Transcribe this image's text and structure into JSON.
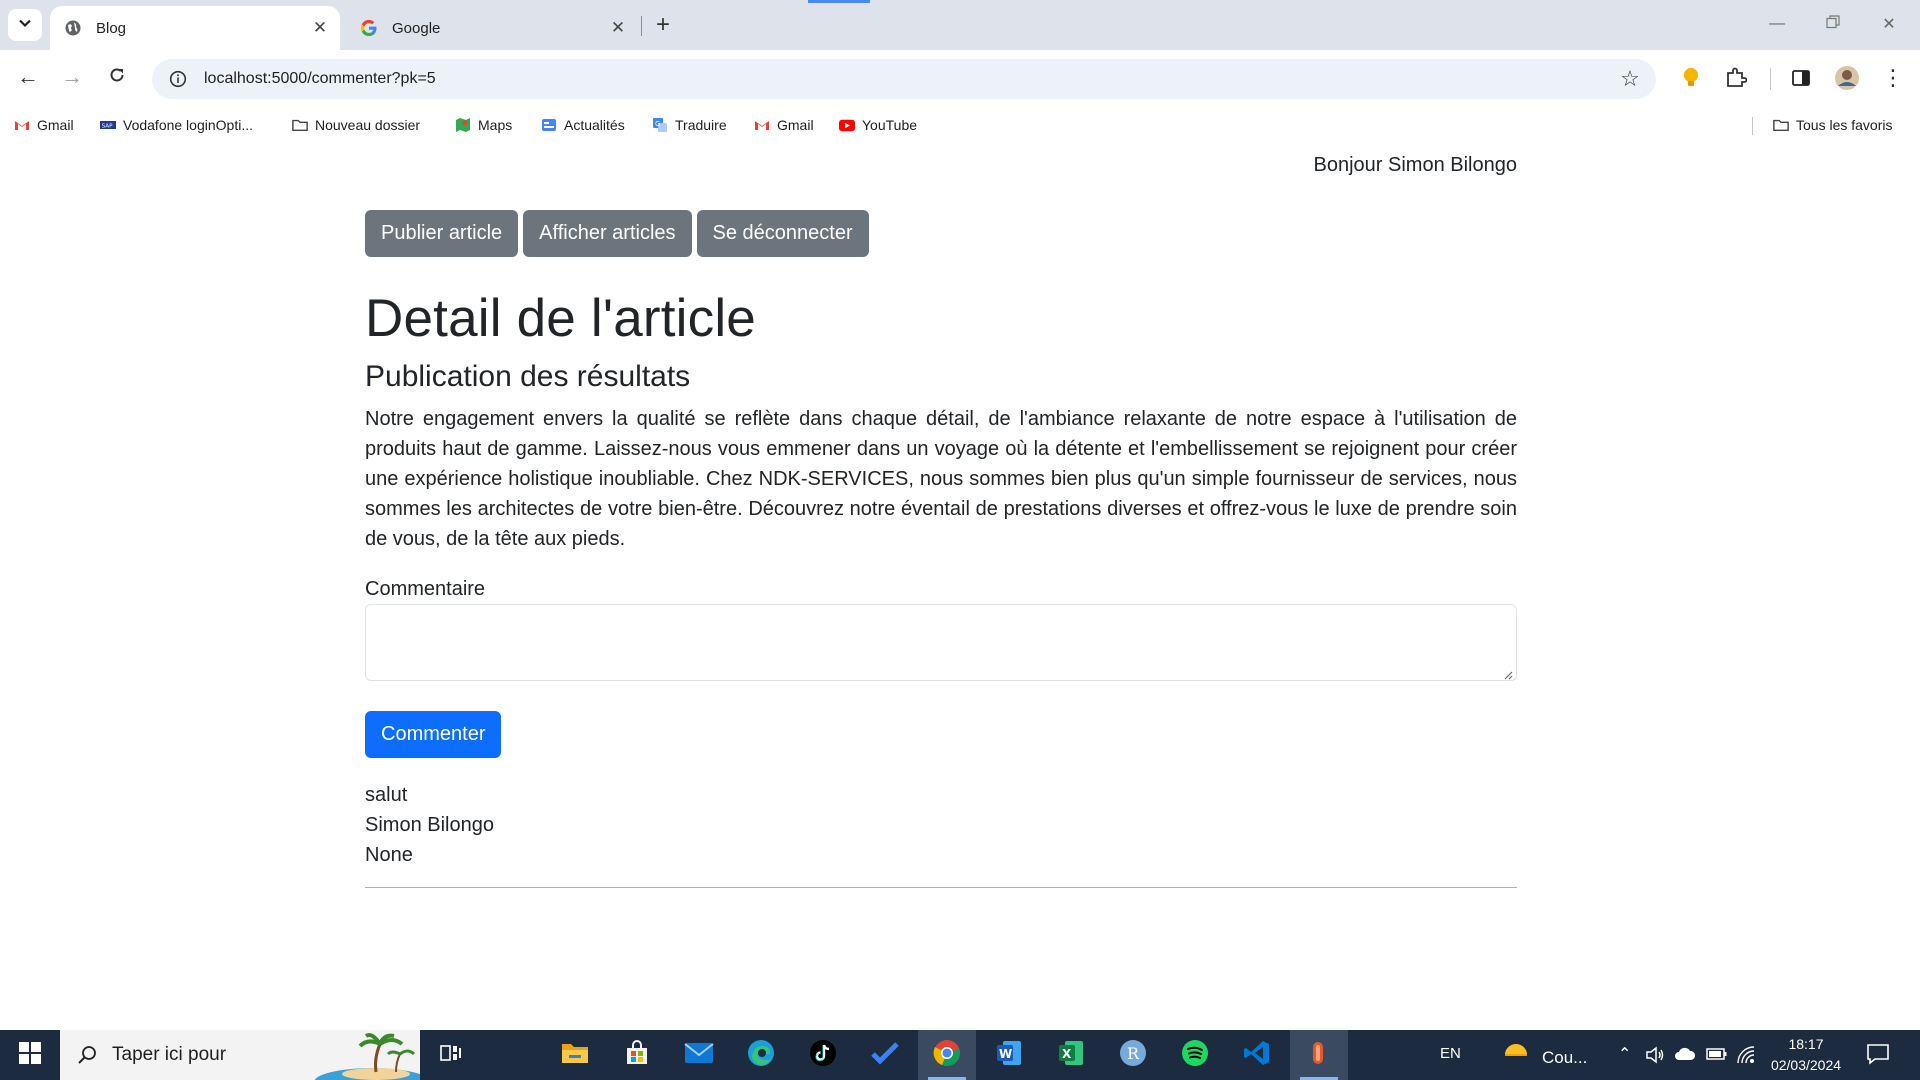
{
  "browser": {
    "tabs": [
      {
        "title": "Blog",
        "active": true
      },
      {
        "title": "Google",
        "active": false
      }
    ],
    "url": "localhost:5000/commenter?pk=5",
    "bookmarks": [
      {
        "label": "Gmail",
        "icon": "gmail-icon"
      },
      {
        "label": "Vodafone loginOpti...",
        "icon": "vodafone-icon"
      },
      {
        "label": "Nouveau dossier",
        "icon": "folder-icon"
      },
      {
        "label": "Maps",
        "icon": "maps-icon"
      },
      {
        "label": "Actualités",
        "icon": "news-icon"
      },
      {
        "label": "Traduire",
        "icon": "translate-icon"
      },
      {
        "label": "Gmail",
        "icon": "gmail-icon"
      },
      {
        "label": "YouTube",
        "icon": "youtube-icon"
      }
    ],
    "all_bookmarks_label": "Tous les favoris"
  },
  "page": {
    "greeting": "Bonjour Simon Bilongo",
    "nav_buttons": [
      "Publier article",
      "Afficher articles",
      "Se déconnecter"
    ],
    "title": "Detail de l'article",
    "article_title": "Publication des résultats",
    "article_body": "Notre engagement envers la qualité se reflète dans chaque détail, de l'ambiance relaxante de notre espace à l'utilisation de produits haut de gamme. Laissez-nous vous emmener dans un voyage où la détente et l'embellissement se rejoignent pour créer une expérience holistique inoubliable. Chez NDK-SERVICES, nous sommes bien plus qu'un simple fournisseur de services, nous sommes les architectes de votre bien-être. Découvrez notre éventail de prestations diverses et offrez-vous le luxe de prendre soin de vous, de la tête aux pieds.",
    "comment_label": "Commentaire",
    "comment_value": "",
    "submit_label": "Commenter",
    "comments": [
      {
        "text": "salut",
        "author": "Simon Bilongo",
        "date": "None"
      }
    ],
    "colors": {
      "primary": "#0d6efd",
      "secondary": "#6c757d"
    }
  },
  "taskbar": {
    "search_placeholder": "Taper ici pour",
    "language": "EN",
    "weather_label": "Cou...",
    "time": "18:17",
    "date": "02/03/2024",
    "apps": [
      "task-view-icon",
      "file-explorer-icon",
      "microsoft-store-icon",
      "mail-icon",
      "edge-icon",
      "tiktok-icon",
      "todo-icon",
      "chrome-icon",
      "word-icon",
      "excel-icon",
      "r-icon",
      "spotify-icon",
      "vscode-icon",
      "app-icon"
    ]
  }
}
